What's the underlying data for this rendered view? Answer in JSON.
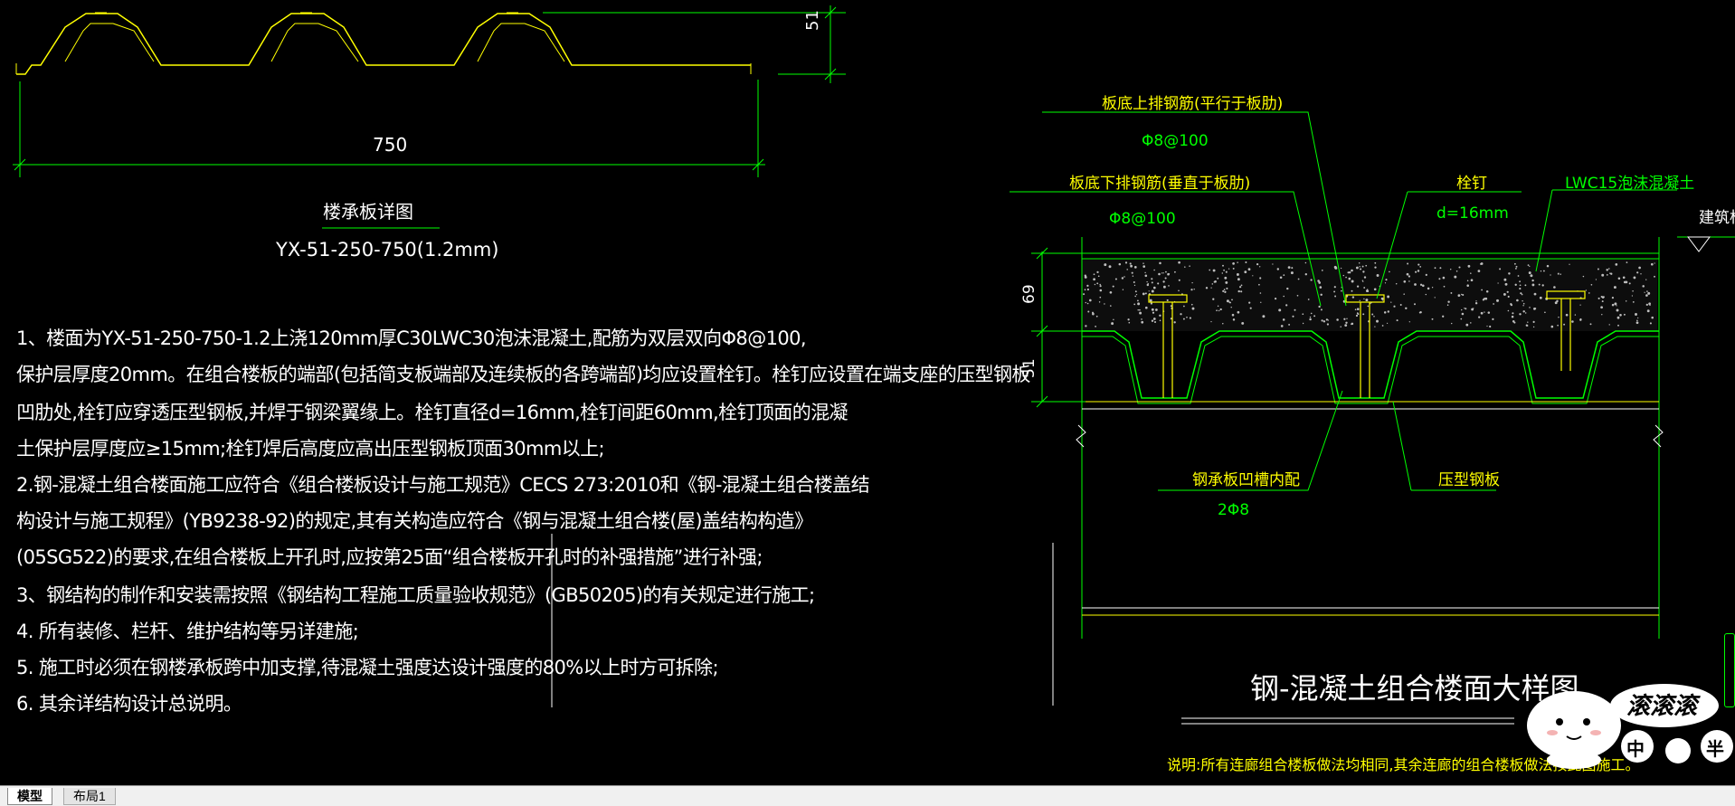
{
  "drawing": {
    "deck_profile": {
      "height_dim": "51",
      "width_dim": "750",
      "title": "楼承板详图",
      "model": "YX-51-250-750(1.2mm)"
    },
    "notes": [
      "1、楼面为YX-51-250-750-1.2上浇120mm厚C30LWC30泡沫混凝土,配筋为双层双向Φ8@100,",
      "保护层厚度20mm。在组合楼板的端部(包括简支板端部及连续板的各跨端部)均应设置栓钉。栓钉应设置在端支座的压型钢板",
      "凹肋处,栓钉应穿透压型钢板,并焊于钢梁翼缘上。栓钉直径d=16mm,栓钉间距60mm,栓钉顶面的混凝",
      "土保护层厚度应≥15mm;栓钉焊后高度应高出压型钢板顶面30mm以上;",
      "2.钢-混凝土组合楼面施工应符合《组合楼板设计与施工规范》CECS 273:2010和《钢-混凝土组合楼盖结",
      "构设计与施工规程》(YB9238-92)的规定,其有关构造应符合《钢与混凝土组合楼(屋)盖结构构造》",
      "(05SG522)的要求,在组合楼板上开孔时,应按第25面“组合楼板开孔时的补强措施”进行补强;",
      "3、钢结构的制作和安装需按照《钢结构工程施工质量验收规范》(GB50205)的有关规定进行施工;",
      "4. 所有装修、栏杆、维护结构等另详建施;",
      "5. 施工时必须在钢楼承板跨中加支撑,待混凝土强度达设计强度的80%以上时方可拆除;",
      "6. 其余详结构设计总说明。"
    ],
    "section": {
      "top_rebar_label": "板底上排钢筋(平行于板肋)",
      "top_rebar_spec": "Φ8@100",
      "bottom_rebar_label": "板底下排钢筋(垂直于板肋)",
      "bottom_rebar_spec": "Φ8@100",
      "stud_label": "栓钉",
      "stud_spec": "d=16mm",
      "concrete_label": "LWC15泡沫混凝土",
      "elevation_label": "建筑标",
      "dim_upper": "69",
      "dim_lower": "51",
      "trough_rebar_label": "钢承板凹槽内配",
      "trough_rebar_spec": "2Φ8",
      "deck_label": "压型钢板",
      "title": "钢-混凝土组合楼面大样图",
      "footnote": "说明:所有连廊组合楼板做法均相同,其余连廊的组合楼板做法按此图施工。"
    },
    "watermark": {
      "line1": "滚滚滚",
      "line2_a": "中",
      "line2_b": "半"
    }
  },
  "tabs": [
    {
      "label": "模型",
      "active": true
    },
    {
      "label": "布局1",
      "active": false
    }
  ],
  "colors": {
    "background": "#000000",
    "dimension_lines": "#00ff00",
    "deck_lines": "#ffff00",
    "text": "#ffffff",
    "annotation_text": "#00ff00"
  }
}
